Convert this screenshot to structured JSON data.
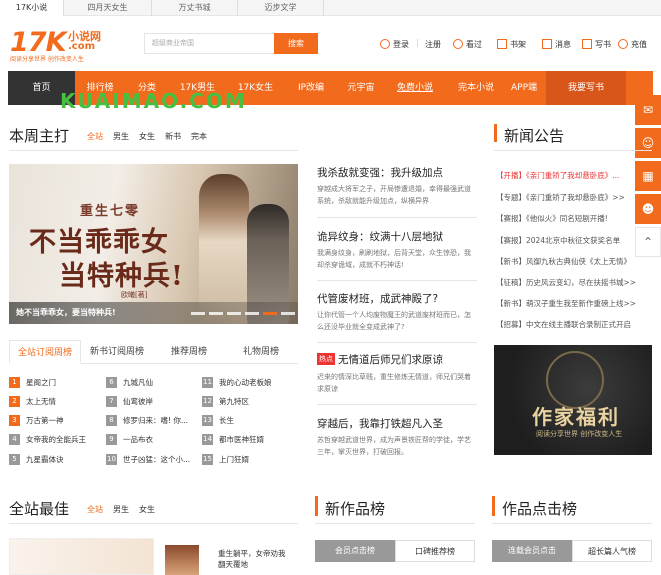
{
  "site_tabs": [
    "17K小说",
    "四月天女生",
    "万丈书城",
    "迈步文学"
  ],
  "logo": {
    "main": "17K",
    "sub": "小说网",
    "com": ".com",
    "slogan": "阅读分享世界 创作改变人生"
  },
  "search": {
    "placeholder": "超级商业帝国",
    "button": "搜索"
  },
  "header_links": [
    "登录",
    "注册",
    "看过",
    "书架",
    "消息",
    "写书",
    "充值"
  ],
  "nav": [
    "首页",
    "排行榜",
    "分类",
    "17K男生",
    "17K女生",
    "IP改编",
    "元宇宙",
    "免费小说",
    "完本小说",
    "APP端",
    "我要写书"
  ],
  "watermark": "KUAIMAO.COM",
  "weekly": {
    "title": "本周主打",
    "tabs": [
      "全站",
      "男生",
      "女生",
      "新书",
      "完本"
    ],
    "banner": {
      "sub": "重生七零",
      "main1": "不当乖乖女",
      "main2": "当特种兵!",
      "author": "欧曦[著]",
      "caption": "她不当乖乖女，要当特种兵!"
    },
    "rank_tabs": [
      "全站订阅周榜",
      "新书订阅周榜",
      "推荐周榜",
      "礼物周榜"
    ],
    "ranks": [
      {
        "n": "1",
        "t": "星阁之门"
      },
      {
        "n": "2",
        "t": "太上无情"
      },
      {
        "n": "3",
        "t": "万古第一神"
      },
      {
        "n": "4",
        "t": "女帝我的全能兵王"
      },
      {
        "n": "5",
        "t": "九星霸体诀"
      },
      {
        "n": "6",
        "t": "九城凡仙"
      },
      {
        "n": "7",
        "t": "仙鸾彼岸"
      },
      {
        "n": "8",
        "t": "修罗归来：嗜! 你..."
      },
      {
        "n": "9",
        "t": "一品布衣"
      },
      {
        "n": "10",
        "t": "世子凶猛：这个小..."
      },
      {
        "n": "11",
        "t": "我的心动老板娘"
      },
      {
        "n": "12",
        "t": "第九特区"
      },
      {
        "n": "13",
        "t": "长生"
      },
      {
        "n": "14",
        "t": "都市医神狂婿"
      },
      {
        "n": "15",
        "t": "上门狂婿"
      }
    ]
  },
  "middle": [
    {
      "title": "我杀敌就变强：我升级加点",
      "desc": "穿越成大将军之子，开局惨遭退婚，幸得最强武道系统，杀敌就能升级加点，纵横异界"
    },
    {
      "title": "诡异纹身：纹满十八层地狱",
      "desc": "我满身纹身，刷刷地狱，后背天堂，众生惊恐，我却杀穿诡域，成就不朽神话!"
    },
    {
      "title": "代管废材班，成武神殿了?",
      "desc": "让你代管一个人均废物魔王的武道废材班而已，怎么还没毕业就全变成武神了?"
    },
    {
      "title": "无情道后师兄们求原谅",
      "hot": "热点",
      "desc": "迟来的情深比草贱，重生修炼无情道，师兄们哭着求原谅"
    },
    {
      "title": "穿越后，我靠打铁超凡入圣",
      "desc": "苏哲穿越武道世界，成为声景铁匠帮的学徒，学艺三年，掌灭世界，打破回报。"
    }
  ],
  "news": {
    "title": "新闻公告",
    "items": [
      {
        "tag": "【开播】",
        "t": "《亲门重矫了我却悬卧底》...",
        "hl": true
      },
      {
        "tag": "【专题】",
        "t": "《亲门重矫了我却悬卧底》>>",
        "hl": false
      },
      {
        "tag": "【赛报】",
        "t": "《他似火》同名短剧开播!",
        "hl": false
      },
      {
        "tag": "【赛报】",
        "t": "2024北京中秋征文获奖名单",
        "hl": false
      },
      {
        "tag": "【新书】",
        "t": "风御九秋古典仙侠《太上无情》",
        "hl": false
      },
      {
        "tag": "【征稿】",
        "t": "历史风云变幻，尽在扶摇书城>>",
        "hl": false
      },
      {
        "tag": "【新书】",
        "t": "萌汉子重生我至新作重磅上线>>",
        "hl": false
      },
      {
        "tag": "【招募】",
        "t": "中文在线主播联合录制正式开启",
        "hl": false
      }
    ],
    "promo": {
      "title": "作家福利",
      "sub": "阅读分享世界 创作改变人生"
    }
  },
  "bottom": {
    "best": {
      "title": "全站最佳",
      "tabs": [
        "全站",
        "男生",
        "女生"
      ]
    },
    "new_rank": {
      "title": "新作品榜",
      "btn1": "会员点击榜",
      "btn2": "口碑推荐榜"
    },
    "click_rank": {
      "title": "作品点击榜",
      "btn1": "连载会员点击",
      "btn2": "超长篇人气榜"
    },
    "book": {
      "line1": "重生躺平，女帝劝我",
      "line2": "翻天覆地"
    }
  }
}
